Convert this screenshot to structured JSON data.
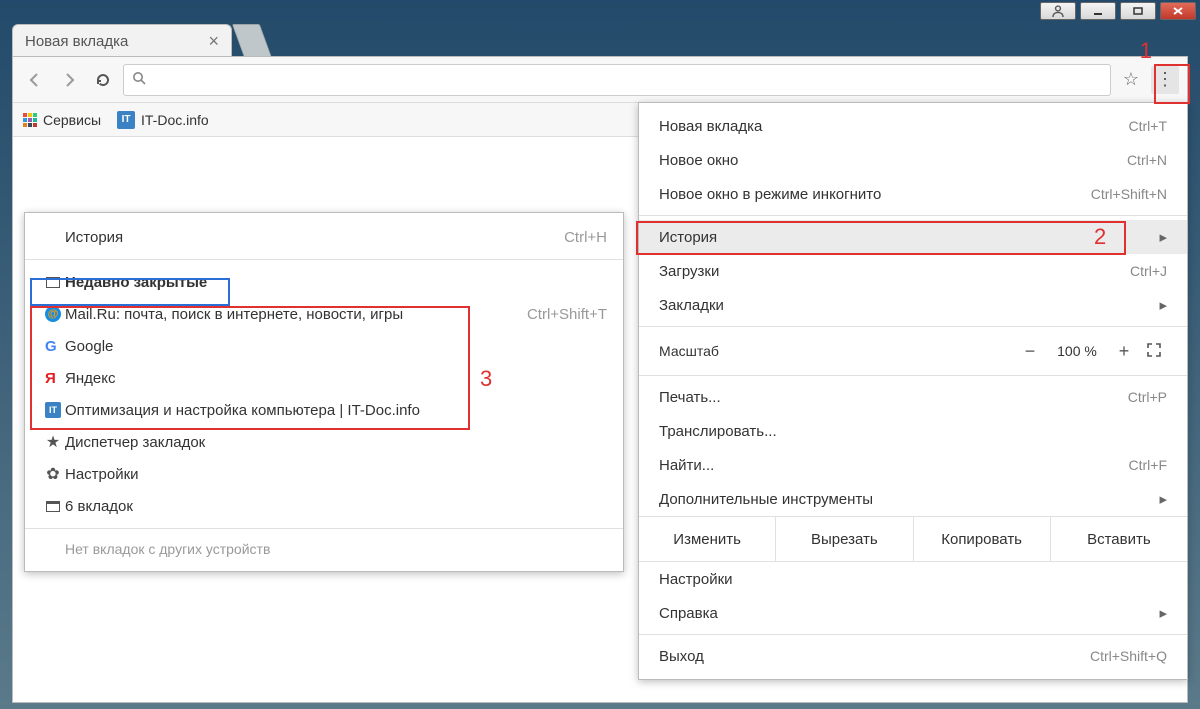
{
  "tab": {
    "title": "Новая вкладка"
  },
  "bookmarksbar": {
    "apps_label": "Сервисы",
    "item1_label": "IT-Doc.info",
    "item1_favicon": "IT"
  },
  "main_menu": {
    "new_tab": {
      "label": "Новая вкладка",
      "shortcut": "Ctrl+T"
    },
    "new_win": {
      "label": "Новое окно",
      "shortcut": "Ctrl+N"
    },
    "incognito": {
      "label": "Новое окно в режиме инкогнито",
      "shortcut": "Ctrl+Shift+N"
    },
    "history": {
      "label": "История"
    },
    "downloads": {
      "label": "Загрузки",
      "shortcut": "Ctrl+J"
    },
    "bookmarks": {
      "label": "Закладки"
    },
    "zoom": {
      "label": "Масштаб",
      "value": "100 %"
    },
    "print": {
      "label": "Печать...",
      "shortcut": "Ctrl+P"
    },
    "cast": {
      "label": "Транслировать..."
    },
    "find": {
      "label": "Найти...",
      "shortcut": "Ctrl+F"
    },
    "more_tools": {
      "label": "Дополнительные инструменты"
    },
    "edit": {
      "label": "Изменить",
      "cut": "Вырезать",
      "copy": "Копировать",
      "paste": "Вставить"
    },
    "settings": {
      "label": "Настройки"
    },
    "help": {
      "label": "Справка"
    },
    "exit": {
      "label": "Выход",
      "shortcut": "Ctrl+Shift+Q"
    }
  },
  "history_menu": {
    "header": {
      "label": "История",
      "shortcut": "Ctrl+H"
    },
    "recent_head": "Недавно закрытые",
    "items": [
      {
        "label": "Mail.Ru: почта, поиск в интернете, новости, игры",
        "shortcut": "Ctrl+Shift+T",
        "icon": "mail"
      },
      {
        "label": "Google",
        "icon": "google"
      },
      {
        "label": "Яндекс",
        "icon": "yandex"
      },
      {
        "label": "Оптимизация и настройка компьютера | IT-Doc.info",
        "icon": "it"
      }
    ],
    "bm_manager": "Диспетчер закладок",
    "settings": "Настройки",
    "six_tabs": "6 вкладок",
    "footer": "Нет вкладок с других устройств"
  },
  "annotations": {
    "n1": "1",
    "n2": "2",
    "n3": "3"
  }
}
